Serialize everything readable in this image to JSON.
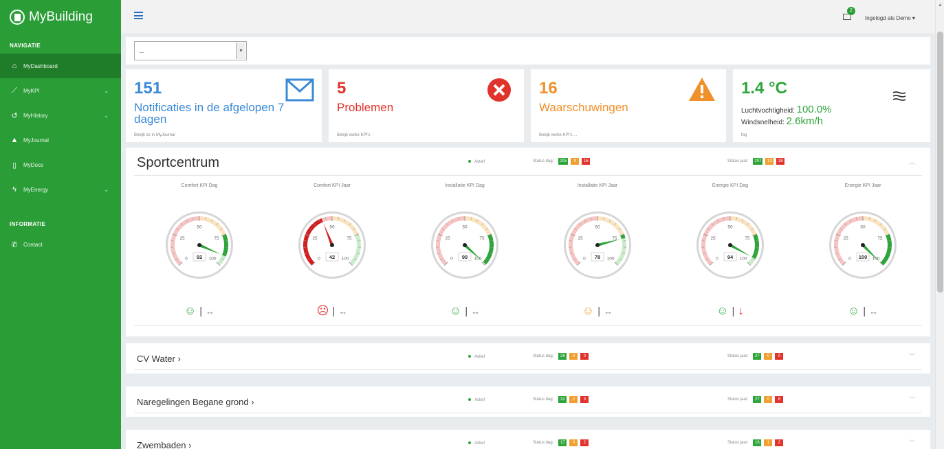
{
  "app": {
    "name": "MyBuilding",
    "user_label": "Ingelogd als Demo ▾",
    "mail_count": "2"
  },
  "sidebar": {
    "nav_heading": "NAVIGATIE",
    "items": [
      {
        "label": "MyDashboard",
        "icon": "home-icon"
      },
      {
        "label": "MyKPI",
        "icon": "line-chart-icon"
      },
      {
        "label": "MyHistory",
        "icon": "history-icon"
      },
      {
        "label": "MyJournal",
        "icon": "warning-icon"
      },
      {
        "label": "MyDocs",
        "icon": "file-icon"
      },
      {
        "label": "MyEnergy",
        "icon": "bolt-icon"
      }
    ],
    "info_heading": "INFORMATIE",
    "info_items": [
      {
        "label": "Contact",
        "icon": "phone-icon"
      }
    ]
  },
  "filter": {
    "value": "--"
  },
  "kpis": {
    "notifications": {
      "value": "151",
      "label": "Notificaties in de afgelopen 7 dagen",
      "link": "Bekijk ze in MyJournal"
    },
    "problems": {
      "value": "5",
      "label": "Problemen",
      "link": "Bekijk welke KPI's"
    },
    "warnings": {
      "value": "16",
      "label": "Waarschuwingen",
      "link": "Bekijk welke KPI's ..."
    },
    "weather": {
      "temp": "1.4 °C",
      "humidity_label": "Luchtvochtigheid:",
      "humidity": "100.0%",
      "wind_label": "Windsnelheid:",
      "wind": "2.6km/h",
      "condition": "fog"
    }
  },
  "sections": [
    {
      "title": "Sportcentrum",
      "active": "Actief",
      "status_day_label": "Status dag:",
      "day": [
        "205",
        "0",
        "16"
      ],
      "status_year_label": "Status jaar:",
      "year": [
        "207",
        "13",
        "38"
      ],
      "gauges": [
        {
          "title": "Comfort KPI Dag",
          "value": 92,
          "mood": "☺",
          "mood_color": "#2ea53a",
          "trend": "↔"
        },
        {
          "title": "Comfort KPI Jaar",
          "value": 42,
          "mood": "☹",
          "mood_color": "#e0332c",
          "trend": "↔"
        },
        {
          "title": "Installatie KPI Dag",
          "value": 99,
          "mood": "☺",
          "mood_color": "#2ea53a",
          "trend": "↔"
        },
        {
          "title": "Installatie KPI Jaar",
          "value": 78,
          "mood": "☺",
          "mood_color": "#f0a030",
          "trend": "↔"
        },
        {
          "title": "Energie KPI Dag",
          "value": 94,
          "mood": "☺",
          "mood_color": "#2ea53a",
          "trend": "↓"
        },
        {
          "title": "Energie KPI Jaar",
          "value": 100,
          "mood": "☺",
          "mood_color": "#2ea53a",
          "trend": "↔"
        }
      ]
    },
    {
      "title": "CV Water ›",
      "active": "Actief",
      "status_day_label": "Status dag:",
      "day": [
        "26",
        "0",
        "0"
      ],
      "status_year_label": "Status jaar:",
      "year": [
        "27",
        "0",
        "0"
      ]
    },
    {
      "title": "Naregelingen Begane grond ›",
      "active": "Actief",
      "status_day_label": "Status dag:",
      "day": [
        "32",
        "2",
        "3"
      ],
      "status_year_label": "Status jaar:",
      "year": [
        "27",
        "0",
        "8"
      ]
    },
    {
      "title": "Zwembaden ›",
      "active": "Actief",
      "status_day_label": "Status dag:",
      "day": [
        "17",
        "0",
        "2"
      ],
      "status_year_label": "Status jaar:",
      "year": [
        "16",
        "1",
        "2"
      ]
    }
  ],
  "colors": {
    "sidebar": "#2a9d37",
    "blue": "#3a8ad6",
    "red": "#e0332c",
    "orange": "#f0902a",
    "green": "#2ea53a"
  }
}
